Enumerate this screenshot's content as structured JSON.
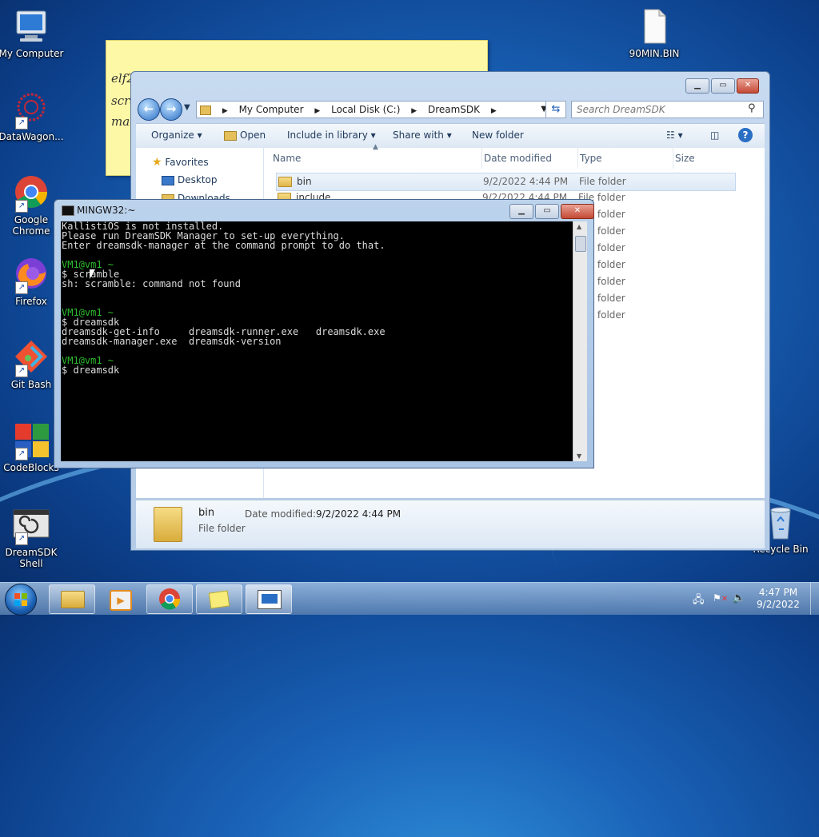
{
  "desktop": {
    "icons": [
      {
        "label": "My Computer"
      },
      {
        "label": "DataWagon..."
      },
      {
        "label": "Google\nChrome"
      },
      {
        "label": "Firefox"
      },
      {
        "label": "Git Bash"
      },
      {
        "label": "CodeBlocks"
      },
      {
        "label": "DreamSDK\nShell"
      },
      {
        "label": "90MIN.BIN"
      },
      {
        "label": "Recycle Bin"
      }
    ]
  },
  "sticky_note": {
    "lines": [
      "elf2",
      "scra",
      "ma"
    ]
  },
  "explorer": {
    "address": [
      "My Computer",
      "Local Disk (C:)",
      "DreamSDK"
    ],
    "search_placeholder": "Search DreamSDK",
    "toolbar": {
      "organize": "Organize",
      "open": "Open",
      "include": "Include in library",
      "share": "Share with",
      "new_folder": "New folder"
    },
    "nav": {
      "favorites": "Favorites",
      "desktop": "Desktop",
      "downloads": "Downloads"
    },
    "columns": {
      "name": "Name",
      "date": "Date modified",
      "type": "Type",
      "size": "Size"
    },
    "rows": [
      {
        "name": "bin",
        "date": "9/2/2022 4:44 PM",
        "type": "File folder"
      },
      {
        "name": "include",
        "date": "9/2/2022 4:44 PM",
        "type": "File folder"
      },
      {
        "type": "File folder"
      },
      {
        "type": "File folder"
      },
      {
        "type": "File folder"
      },
      {
        "type": "File folder"
      },
      {
        "type": "File folder"
      },
      {
        "type": "File folder"
      },
      {
        "type": "File folder"
      }
    ],
    "details": {
      "name": "bin",
      "date_label": "Date modified:",
      "date": "9/2/2022 4:44 PM",
      "type": "File folder"
    }
  },
  "terminal": {
    "title": "MINGW32:~",
    "lines": [
      {
        "text": "KallistiOS is not installed.",
        "color": "white"
      },
      {
        "text": "Please run DreamSDK Manager to set-up everything.",
        "color": "white"
      },
      {
        "text": "Enter dreamsdk-manager at the command prompt to do that.",
        "color": "white"
      },
      {
        "text": "",
        "color": "white"
      },
      {
        "text": "VM1@vm1 ~",
        "color": "green"
      },
      {
        "text": "$ scramble",
        "color": "white"
      },
      {
        "text": "sh: scramble: command not found",
        "color": "white"
      },
      {
        "text": "",
        "color": "white"
      },
      {
        "text": "VM1@vm1 ~",
        "color": "green"
      },
      {
        "text": "$ dreamsdk",
        "color": "white"
      },
      {
        "text": "dreamsdk-get-info     dreamsdk-runner.exe   dreamsdk.exe",
        "color": "white"
      },
      {
        "text": "dreamsdk-manager.exe  dreamsdk-version",
        "color": "white"
      },
      {
        "text": "",
        "color": "white"
      },
      {
        "text": "VM1@vm1 ~",
        "color": "green"
      },
      {
        "text": "$ dreamsdk",
        "color": "white"
      }
    ]
  },
  "taskbar": {
    "time": "4:47 PM",
    "date": "9/2/2022"
  }
}
